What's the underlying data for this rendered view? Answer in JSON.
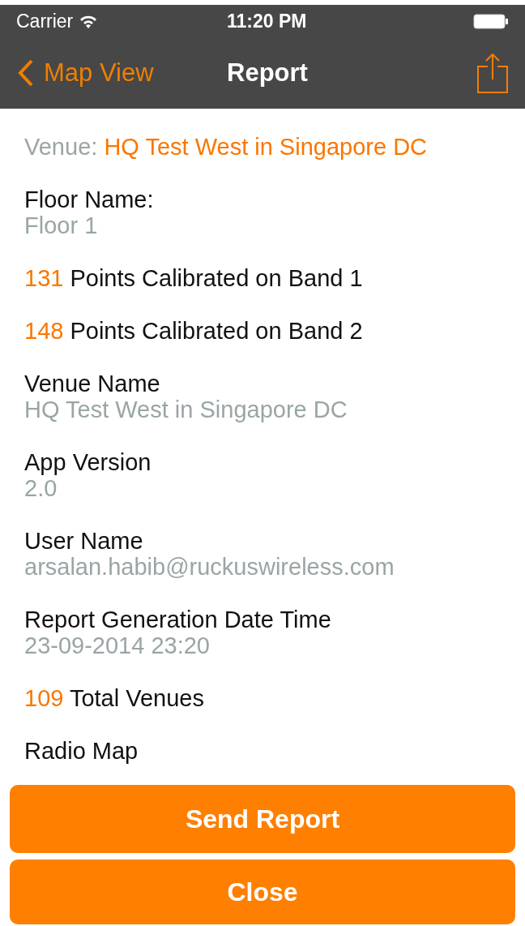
{
  "status_bar": {
    "carrier": "Carrier",
    "time": "11:20 PM"
  },
  "nav": {
    "back": "Map View",
    "title": "Report"
  },
  "items": [
    {
      "kind": "venue",
      "label": "Venue:",
      "value": "HQ Test West in Singapore DC"
    },
    {
      "kind": "field",
      "label": "Floor Name:",
      "value": "Floor 1"
    },
    {
      "kind": "count",
      "count": "131",
      "label": "Points Calibrated on Band 1"
    },
    {
      "kind": "count",
      "count": "148",
      "label": "Points Calibrated on Band 2"
    },
    {
      "kind": "field",
      "label": "Venue Name",
      "value": "HQ Test West in Singapore DC"
    },
    {
      "kind": "field",
      "label": "App Version",
      "value": "2.0"
    },
    {
      "kind": "field",
      "label": "User Name",
      "value": "arsalan.habib@ruckuswireless.com"
    },
    {
      "kind": "field",
      "label": "Report Generation Date Time",
      "value": "23-09-2014 23:20"
    },
    {
      "kind": "count",
      "count": "109",
      "label": "Total Venues"
    },
    {
      "kind": "field",
      "label": "Radio Map"
    }
  ],
  "buttons": [
    "Send Report",
    "Close"
  ]
}
